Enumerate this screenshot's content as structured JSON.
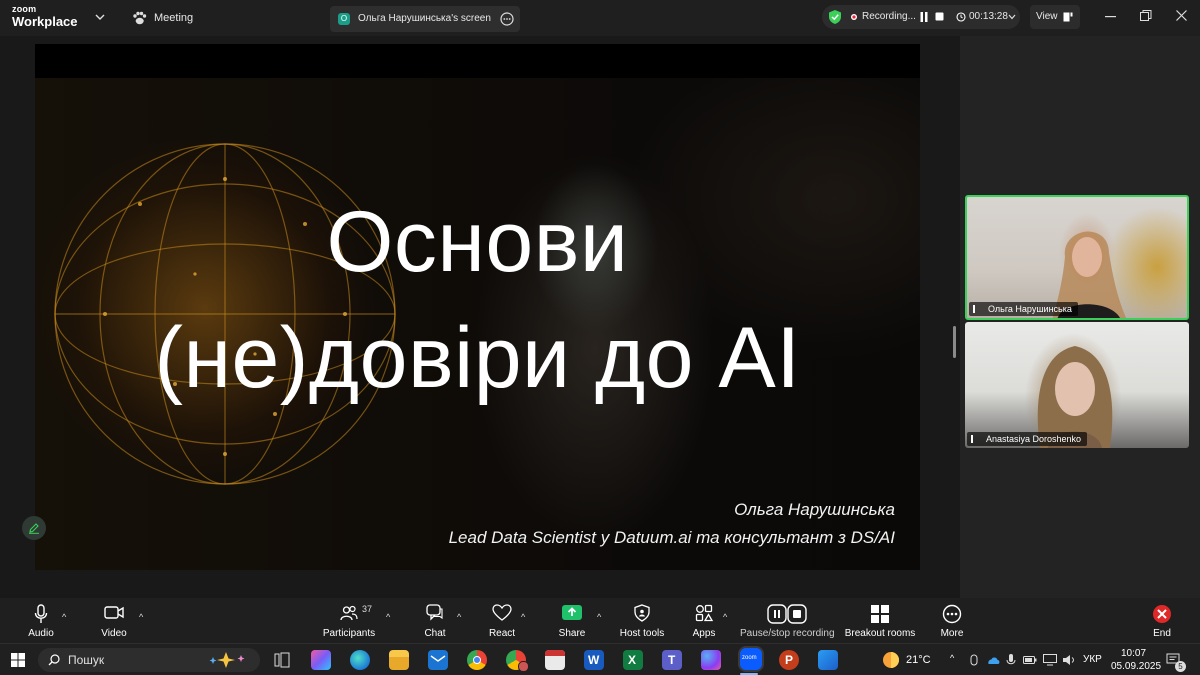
{
  "app": {
    "brand_top": "zoom",
    "brand_bottom": "Workplace"
  },
  "titlebar": {
    "meeting_label": "Meeting",
    "share_tab_label": "Ольга Нарушинська's screen",
    "share_tab_initial": "O",
    "recording_label": "Recording...",
    "timer": "00:13:28",
    "view_label": "View"
  },
  "slide": {
    "title_line1": "Основи",
    "title_line2": "(не)довіри до AI",
    "author": "Ольга Нарушинська",
    "role": "Lead Data Scientist у Datuum.ai та консультант з DS/AI"
  },
  "participants_gallery": [
    {
      "name": "Ольга Нарушинська",
      "active_speaker": true
    },
    {
      "name": "Anastasiya Doroshenko",
      "active_speaker": false
    }
  ],
  "toolbar": {
    "audio": "Audio",
    "video": "Video",
    "participants": "Participants",
    "participants_count": "37",
    "chat": "Chat",
    "react": "React",
    "share": "Share",
    "host_tools": "Host tools",
    "apps": "Apps",
    "pause_stop_recording": "Pause/stop recording",
    "breakout_rooms": "Breakout rooms",
    "more": "More",
    "end": "End"
  },
  "taskbar": {
    "search_placeholder": "Пошук",
    "weather_temp": "21°C",
    "language": "УКР",
    "time": "10:07",
    "date": "05.09.2025",
    "notification_count": "5"
  },
  "colors": {
    "active_speaker_border": "#3ccf5a",
    "share_button": "#1fc16b",
    "end_button": "#e02828",
    "recording_shield": "#3ccf5a"
  }
}
